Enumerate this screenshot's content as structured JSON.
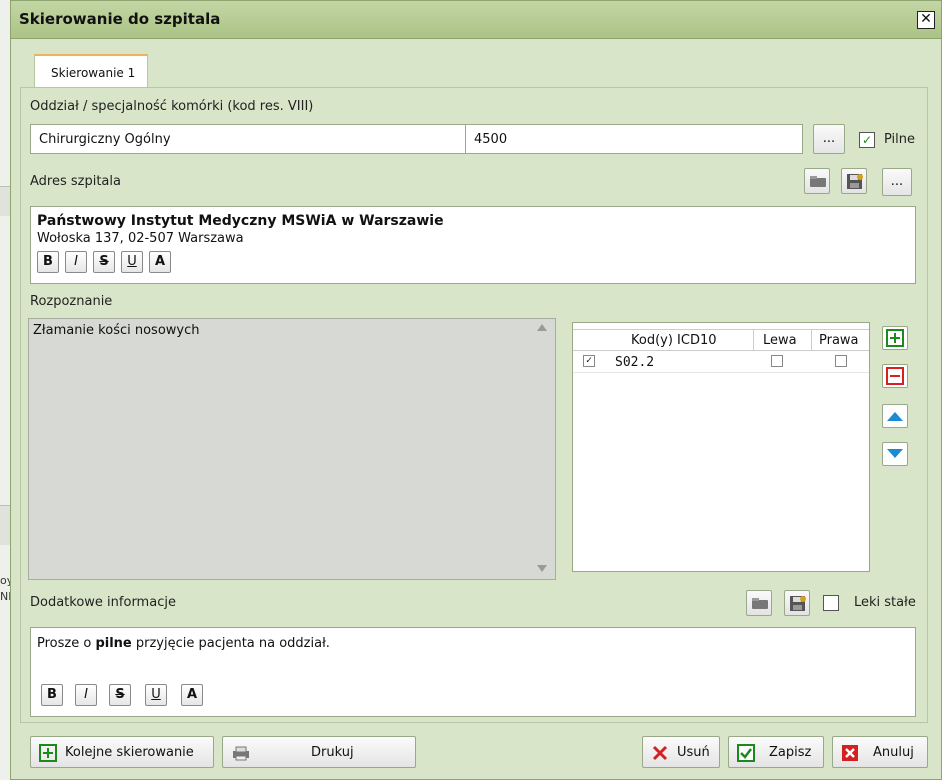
{
  "dialog": {
    "title": "Skierowanie do szpitala",
    "close_symbol": "✕"
  },
  "background": {
    "fragment_1": "oy",
    "fragment_2": "NI"
  },
  "tabs": [
    {
      "label": "Skierowanie 1",
      "active": true
    }
  ],
  "department": {
    "label": "Oddział / specjalność komórki (kod res. VIII)",
    "name_value": "Chirurgiczny Ogólny",
    "code_value": "4500",
    "browse_label": "...",
    "urgent_label": "Pilne",
    "urgent_checked": true
  },
  "hospital": {
    "label": "Adres szpitala",
    "browse_label": "...",
    "name": "Państwowy Instytut Medyczny MSWiA w Warszawie",
    "address": "Wołoska 137, 02-507 Warszawa"
  },
  "diagnosis": {
    "label": "Rozpoznanie",
    "text": "Złamanie kości nosowych"
  },
  "icd_table": {
    "columns": [
      "Kod(y) ICD10",
      "Lewa",
      "Prawa"
    ],
    "rows": [
      {
        "checked": true,
        "code": "S02.2",
        "left": false,
        "right": false
      }
    ]
  },
  "additional": {
    "label": "Dodatkowe informacje",
    "chronic_label": "Leki stałe",
    "chronic_checked": false,
    "text_before": "Prosze o ",
    "text_bold": "pilne",
    "text_after": " przyjęcie pacjenta na oddział."
  },
  "format_buttons": [
    "B",
    "I",
    "S",
    "U",
    "A"
  ],
  "footer": {
    "next_label": "Kolejne skierowanie",
    "print_label": "Drukuj",
    "delete_label": "Usuń",
    "save_label": "Zapisz",
    "cancel_label": "Anuluj"
  },
  "colors": {
    "accent_green": "#1a8a1a",
    "delete_red": "#d42020",
    "arrow_blue": "#1a8ad4",
    "dialog_bg": "#d9e5c8"
  },
  "icons": {
    "folder": "folder-open-icon",
    "save": "floppy-save-icon",
    "add": "plus-square-icon",
    "remove": "minus-square-icon",
    "up": "arrow-up-icon",
    "down": "arrow-down-icon",
    "print": "printer-icon"
  }
}
